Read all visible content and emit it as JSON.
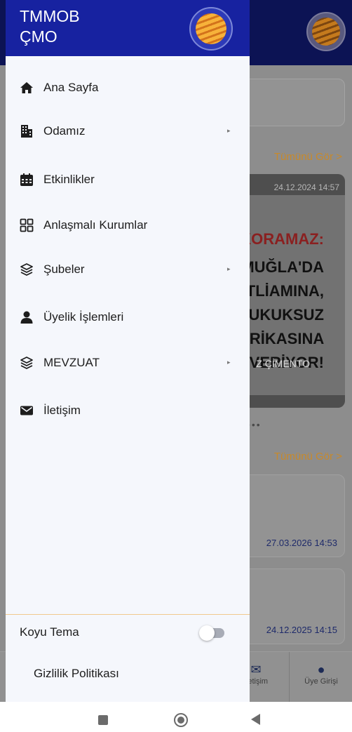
{
  "drawer": {
    "brand_line1": "TMMOB",
    "brand_line2": "ÇMO",
    "items": [
      {
        "label": "Ana Sayfa",
        "icon": "home-icon",
        "has_submenu": false
      },
      {
        "label": "Odamız",
        "icon": "building-icon",
        "has_submenu": true
      },
      {
        "label": "Etkinlikler",
        "icon": "calendar-icon",
        "has_submenu": false
      },
      {
        "label": "Anlaşmalı Kurumlar",
        "icon": "grid-icon",
        "has_submenu": false
      },
      {
        "label": "Şubeler",
        "icon": "layers-icon",
        "has_submenu": true
      },
      {
        "label": "Üyelik İşlemleri",
        "icon": "user-icon",
        "has_submenu": false
      },
      {
        "label": "MEVZUAT",
        "icon": "layers-icon",
        "has_submenu": true
      },
      {
        "label": "İletişim",
        "icon": "envelope-icon",
        "has_submenu": false
      }
    ],
    "submenu_arrow": "▸",
    "theme_label": "Koyu Tema",
    "dark_theme_enabled": false,
    "privacy_label": "Gizlilik Politikası"
  },
  "background": {
    "see_all_1": "Tümünü Gör >",
    "see_all_2": "Tümünü Gör >",
    "news_date": "24.12.2024 14:57",
    "news_lines": [
      "KORAMAZ:",
      "MUĞLA'DA",
      "TLİAMINA,",
      "UKUKSUZ",
      "BRİKASINA",
      "VERİYOR!"
    ],
    "news_subline": "Z ÇİMENTO",
    "dots": "•••",
    "event_date_1": "27.03.2026 14:53",
    "event_date_2": "24.12.2025 14:15",
    "nav_contact_label": "İletişim",
    "nav_login_label": "Üye Girişi"
  },
  "colors": {
    "drawer_header": "#1722a0",
    "app_header": "#0c1354",
    "accent_orange": "#f0a030",
    "drawer_bg": "#f5f7fc"
  }
}
